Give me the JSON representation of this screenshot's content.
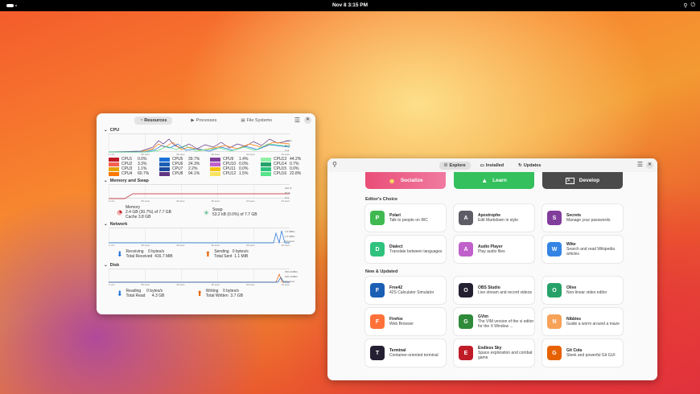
{
  "topbar": {
    "clock": "Nov 8  3:15 PM"
  },
  "resources": {
    "tabs": [
      "Resources",
      "Processes",
      "File Systems"
    ],
    "cpu": {
      "title": "CPU",
      "y_ticks": [
        "100 %",
        "50 %",
        "0 %"
      ],
      "x_ticks": [
        "1 min",
        "50 secs",
        "40 secs",
        "30 secs",
        "20 secs",
        "10 secs"
      ],
      "cores": [
        {
          "name": "CPU1",
          "value": "0.0%",
          "color": "#c01c28"
        },
        {
          "name": "CPU5",
          "value": "39.7%",
          "color": "#1c71d8"
        },
        {
          "name": "CPU9",
          "value": "1.4%",
          "color": "#813d9c"
        },
        {
          "name": "CPU13",
          "value": "44.2%",
          "color": "#8ff0a4"
        },
        {
          "name": "CPU2",
          "value": "3.3%",
          "color": "#f66151"
        },
        {
          "name": "CPU6",
          "value": "24.3%",
          "color": "#1a5fb4"
        },
        {
          "name": "CPU10",
          "value": "0.0%",
          "color": "#c061cb"
        },
        {
          "name": "CPU14",
          "value": "0.7%",
          "color": "#26a269"
        },
        {
          "name": "CPU3",
          "value": "1.1%",
          "color": "#e5a50a"
        },
        {
          "name": "CPU7",
          "value": "2.2%",
          "color": "#1c4a9c"
        },
        {
          "name": "CPU11",
          "value": "0.0%",
          "color": "#f5c211"
        },
        {
          "name": "CPU15",
          "value": "0.0%",
          "color": "#2ec27e"
        },
        {
          "name": "CPU4",
          "value": "60.7%",
          "color": "#ff7800"
        },
        {
          "name": "CPU8",
          "value": "94.1%",
          "color": "#613583"
        },
        {
          "name": "CPU12",
          "value": "1.5%",
          "color": "#f8e45c"
        },
        {
          "name": "CPU16",
          "value": "22.8%",
          "color": "#57e389"
        }
      ]
    },
    "memory": {
      "title": "Memory and Swap",
      "y_ticks": [
        "100 %",
        "50 %",
        "0 %"
      ],
      "x_ticks": [
        "1 min",
        "50 secs",
        "40 secs",
        "30 secs",
        "20 secs",
        "10 secs"
      ],
      "mem_label": "Memory",
      "mem_value": "2.4 GB (30.7%) of 7.7 GB",
      "mem_cache": "Cache 3.8 GB",
      "swap_label": "Swap",
      "swap_value": "53.2 kB (0.0%) of 7.7 GB"
    },
    "network": {
      "title": "Network",
      "y_ticks": [
        "1.5 MiB/s",
        "1.0 MiB/s",
        "0 bytes/s"
      ],
      "x_ticks": [
        "1 min",
        "50 secs",
        "40 secs",
        "30 secs",
        "20 secs",
        "10 secs"
      ],
      "recv_label": "Receiving",
      "recv_value": "0 bytes/s",
      "recv_total_label": "Total Received",
      "recv_total": "416.7 MiB",
      "send_label": "Sending",
      "send_value": "0 bytes/s",
      "send_total_label": "Total Sent",
      "send_total": "1.1 MiB"
    },
    "disk": {
      "title": "Disk",
      "y_ticks": [
        "250.0 MiB/s",
        "150.0 MiB/s",
        "0 bytes/s"
      ],
      "x_ticks": [
        "1 min",
        "50 secs",
        "40 secs",
        "30 secs",
        "20 secs",
        "10 secs"
      ],
      "read_label": "Reading",
      "read_value": "0 bytes/s",
      "read_total_label": "Total Read",
      "read_total": "4.3 GB",
      "write_label": "Writing",
      "write_value": "0 bytes/s",
      "write_total_label": "Total Written",
      "write_total": "3.7 GB"
    }
  },
  "software": {
    "tabs": [
      "Explore",
      "Installed",
      "Updates"
    ],
    "categories": [
      "Socialize",
      "Learn",
      "Develop"
    ],
    "editors_choice_title": "Editor's Choice",
    "editors_choice": [
      {
        "name": "Polari",
        "desc": "Talk to people on IRC",
        "color": "#3fb950",
        "icon": "polari-icon"
      },
      {
        "name": "Apostrophe",
        "desc": "Edit Markdown in style",
        "color": "#5e5c64",
        "icon": "apostrophe-icon"
      },
      {
        "name": "Secrets",
        "desc": "Manage your passwords",
        "color": "#813d9c",
        "icon": "secrets-icon"
      },
      {
        "name": "Dialect",
        "desc": "Translate between languages",
        "color": "#2ec27e",
        "icon": "dialect-icon"
      },
      {
        "name": "Audio Player",
        "desc": "Play audio files",
        "color": "#c061cb",
        "icon": "audio-player-icon"
      },
      {
        "name": "Wike",
        "desc": "Search and read Wikipedia articles",
        "color": "#3584e4",
        "icon": "wike-icon"
      }
    ],
    "new_title": "New & Updated",
    "new_updated": [
      {
        "name": "Free42",
        "desc": "42S Calculator Simulator",
        "color": "#1a5fb4",
        "icon": "free42-icon"
      },
      {
        "name": "OBS Studio",
        "desc": "Live stream and record videos",
        "color": "#241f31",
        "icon": "obs-studio-icon"
      },
      {
        "name": "Olive",
        "desc": "Non-linear video editor",
        "color": "#26a269",
        "icon": "olive-icon"
      },
      {
        "name": "Firefox",
        "desc": "Web Browser",
        "color": "#ff7139",
        "icon": "firefox-icon"
      },
      {
        "name": "GVim",
        "desc": "The VIM version of the vi editor for the X Window ...",
        "color": "#2f8a3a",
        "icon": "gvim-icon"
      },
      {
        "name": "Nibbles",
        "desc": "Guide a worm around a maze",
        "color": "#f6a259",
        "icon": "nibbles-icon"
      },
      {
        "name": "Terminal",
        "desc": "Container-oriented terminal",
        "color": "#241f31",
        "icon": "terminal-icon"
      },
      {
        "name": "Endless Sky",
        "desc": "Space exploration and combat game",
        "color": "#c01c28",
        "icon": "endless-sky-icon"
      },
      {
        "name": "Git Cola",
        "desc": "Sleek and powerful Git GUI",
        "color": "#e66100",
        "icon": "git-cola-icon"
      }
    ]
  }
}
